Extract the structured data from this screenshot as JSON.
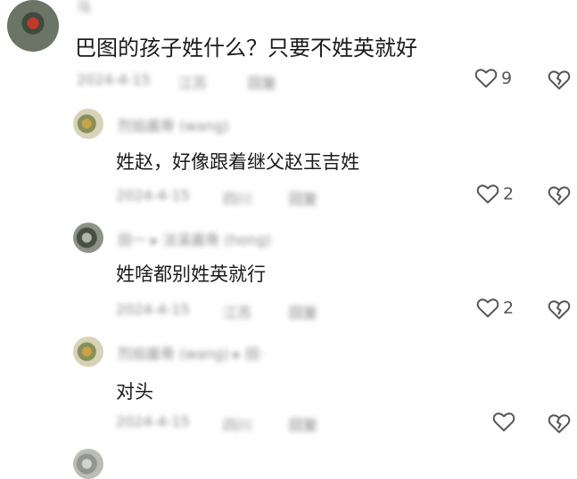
{
  "comments": [
    {
      "id": "c1",
      "username": "马",
      "text": "巴图的孩子姓什么？只要不姓英就好",
      "date": "2024-4-15",
      "location": "江苏",
      "reply_label": "回复",
      "likes": "9"
    }
  ],
  "replies": [
    {
      "id": "r1",
      "username": "烈焰酱骨 (wang)",
      "text": "姓赵，好像跟着继父赵玉吉姓",
      "date": "2024-4-15",
      "location": "四川",
      "reply_label": "回复",
      "likes": "2"
    },
    {
      "id": "r2",
      "username": "田一 ▸ 法溪酱骨 (hong)",
      "text": "姓啥都别姓英就行",
      "date": "2024-4-15",
      "location": "江苏",
      "reply_label": "回复",
      "likes": "2"
    },
    {
      "id": "r3",
      "username": "烈焰酱骨 (wang) ▸ 田·",
      "text": "对头",
      "date": "2024-4-15",
      "location": "四川",
      "reply_label": "回复",
      "likes": ""
    }
  ],
  "icons": {
    "like": "heart-outline-icon",
    "dislike": "broken-heart-icon"
  },
  "colors": {
    "text": "#1a1a1a",
    "meta": "#8a8a8a",
    "icon": "#555555"
  }
}
